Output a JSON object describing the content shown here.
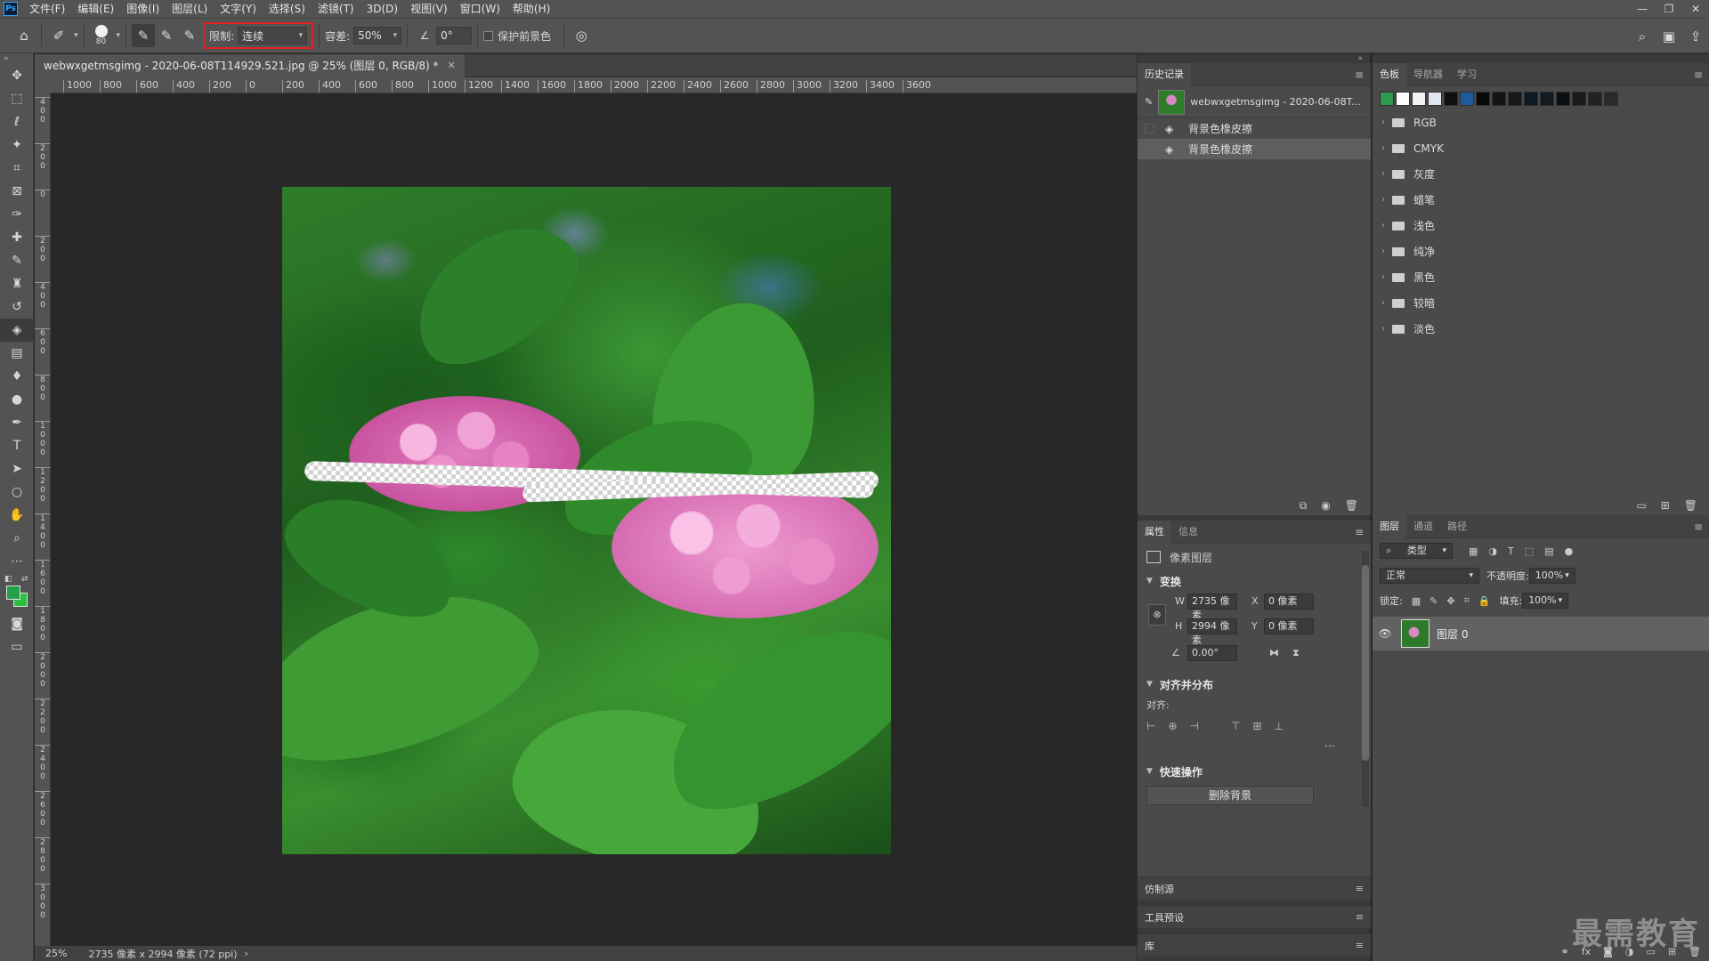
{
  "menubar": {
    "logo": "Ps",
    "items": [
      "文件(F)",
      "编辑(E)",
      "图像(I)",
      "图层(L)",
      "文字(Y)",
      "选择(S)",
      "滤镜(T)",
      "3D(D)",
      "视图(V)",
      "窗口(W)",
      "帮助(H)"
    ],
    "window_controls": [
      "—",
      "❐",
      "✕"
    ]
  },
  "options": {
    "brush_size": "80",
    "limit_label": "限制:",
    "limit_value": "连续",
    "tolerance_label": "容差:",
    "tolerance_value": "50%",
    "angle_value": "0°",
    "protect_fg_label": "保护前景色"
  },
  "document": {
    "tab_title": "webwxgetmsgimg - 2020-06-08T114929.521.jpg @ 25% (图层 0, RGB/8) *",
    "ruler_h_labels": [
      "1000",
      "800",
      "600",
      "400",
      "200",
      "0",
      "200",
      "400",
      "600",
      "800",
      "1000",
      "1200",
      "1400",
      "1600",
      "1800",
      "2000",
      "2200",
      "2400",
      "2600",
      "2800",
      "3000",
      "3200",
      "3400",
      "3600"
    ],
    "ruler_v_labels": [
      "4 0 0",
      "2 0 0",
      "0",
      "2 0 0",
      "4 0 0",
      "6 0 0",
      "8 0 0",
      "1 0 0 0",
      "1 2 0 0",
      "1 4 0 0",
      "1 6 0 0",
      "1 8 0 0",
      "2 0 0 0",
      "2 2 0 0",
      "2 4 0 0",
      "2 6 0 0",
      "2 8 0 0",
      "3 0 0 0"
    ],
    "zoom": "25%",
    "doc_info": "2735 像素 x 2994 像素 (72 ppi)",
    "status_arrow": "›"
  },
  "history": {
    "tabs": [
      "历史记录"
    ],
    "snapshot_label": "webwxgetmsgimg - 2020-06-08T...",
    "states": [
      "背景色橡皮擦",
      "背景色橡皮擦"
    ]
  },
  "properties": {
    "tabs": [
      "属性",
      "信息"
    ],
    "layer_type": "像素图层",
    "transform_title": "变换",
    "w_label": "W",
    "w_value": "2735 像素",
    "x_label": "X",
    "x_value": "0 像素",
    "h_label": "H",
    "h_value": "2994 像素",
    "y_label": "Y",
    "y_value": "0 像素",
    "angle_value": "0.00°",
    "align_title": "对齐并分布",
    "align_label": "对齐:",
    "quick_title": "快速操作",
    "remove_bg_button": "删除背景"
  },
  "collapsed_panels": [
    "仿制源",
    "工具预设",
    "库"
  ],
  "swatches": {
    "tabs": [
      "色板",
      "导航器",
      "学习"
    ],
    "recent_colors": [
      "#2e9a4b",
      "#ffffff",
      "#f2f2f2",
      "#dfe6f2",
      "#101010",
      "#1f5a9a",
      "#0a0a0a",
      "#141414",
      "#181818",
      "#0d1a24",
      "#131a20",
      "#0a0f14",
      "#1a1a1a",
      "#222222",
      "#2a2a2a"
    ],
    "groups": [
      "RGB",
      "CMYK",
      "灰度",
      "蜡笔",
      "浅色",
      "纯净",
      "黑色",
      "较暗",
      "淡色"
    ]
  },
  "layers": {
    "tabs": [
      "图层",
      "通道",
      "路径"
    ],
    "filter_label": "类型",
    "blend_mode": "正常",
    "opacity_label": "不透明度:",
    "opacity_value": "100%",
    "lock_label": "锁定:",
    "fill_label": "填充:",
    "fill_value": "100%",
    "layer_name": "图层 0"
  },
  "watermark": "最需教育"
}
